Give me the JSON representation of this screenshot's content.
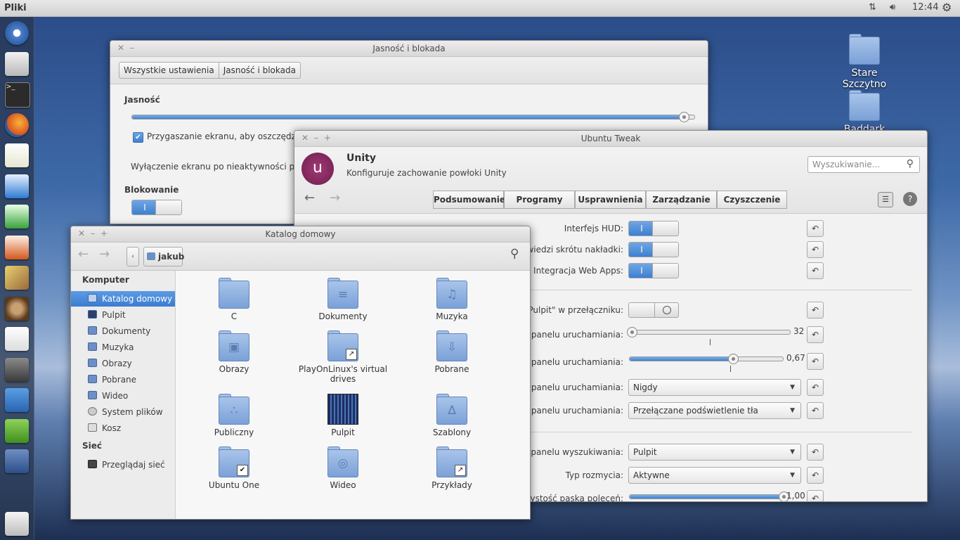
{
  "top_panel": {
    "app_title": "Pliki",
    "clock": "12:44"
  },
  "launcher": {
    "icons": [
      "ubuntu-dash-icon",
      "files-icon",
      "terminal-icon",
      "firefox-icon",
      "text-editor-icon",
      "writer-icon",
      "calc-icon",
      "impress-icon",
      "gimp-icon",
      "sound-icon",
      "apps-icon",
      "settings-icon",
      "system-monitor-icon",
      "ubuntu-tweak-icon",
      "workspace-switcher-icon",
      "trash-icon"
    ]
  },
  "desktop": {
    "icons": [
      {
        "label": "Stare Szczytno"
      },
      {
        "label": "Baddark"
      }
    ]
  },
  "brightness_window": {
    "title": "Jasność i blokada",
    "breadcrumb": [
      "Wszystkie ustawienia",
      "Jasność i blokada"
    ],
    "brightness_heading": "Jasność",
    "brightness_level": 0.98,
    "dim_checkbox_label": "Przygaszanie ekranu, aby oszczędzać zasilanie",
    "dim_checked": true,
    "screen_off_label": "Wyłączenie ekranu po nieaktywności przez:",
    "lock_heading": "Blokowanie",
    "lock_toggle_on": "I"
  },
  "tweak_window": {
    "title": "Ubuntu Tweak",
    "app_name": "Unity",
    "app_desc": "Konfiguruje zachowanie powłoki Unity",
    "logo_text": "unity",
    "search_placeholder": "Wyszukiwanie...",
    "tabs": [
      "Podsumowanie",
      "Programy",
      "Usprawnienia",
      "Zarządzanie",
      "Czyszczenie"
    ],
    "toggle_on": "I",
    "rows": {
      "hud": "Interfejs HUD:",
      "shortcut": "Podpowiedzi skrótu nakładki:",
      "webapps": "Integracja Web Apps:",
      "desktop_switcher": "Ikona \"Pokaż Pulpit\" w przełączniku:",
      "icon_size": "Rozmiar ikon panelu uruchamiania:",
      "icon_size_value": "32",
      "icon_size_level": 0.0,
      "opacity": "Przezroczystość panelu uruchamiania:",
      "opacity_value": "0,67",
      "opacity_level": 0.67,
      "hide_mode": "Tryb ukrywania panelu uruchamiania:",
      "hide_value": "Nigdy",
      "backlight": "Podświetlenie ikon panelu uruchamiania:",
      "backlight_value": "Przełączane podświetlenie tła",
      "search_size": "Rozmiar panelu wyszukiwania:",
      "search_size_value": "Pulpit",
      "blur_type": "Typ rozmycia:",
      "blur_value": "Aktywne",
      "panel_opacity": "Przezroczystość paska poleceń:",
      "panel_opacity_value": "1,00",
      "panel_opacity_level": 1.0
    }
  },
  "files_window": {
    "title": "Katalog domowy",
    "path_button": "jakub",
    "sidebar": {
      "computer_heading": "Komputer",
      "items": [
        "Katalog domowy",
        "Pulpit",
        "Dokumenty",
        "Muzyka",
        "Obrazy",
        "Pobrane",
        "Wideo",
        "System plików",
        "Kosz"
      ],
      "network_heading": "Sieć",
      "network_items": [
        "Przeglądaj sieć"
      ]
    },
    "items": [
      {
        "name": "C",
        "icon": "folder-icon"
      },
      {
        "name": "Dokumenty",
        "icon": "documents-folder-icon"
      },
      {
        "name": "Muzyka",
        "icon": "music-folder-icon"
      },
      {
        "name": "Obrazy",
        "icon": "pictures-folder-icon"
      },
      {
        "name": "PlayOnLinux's virtual drives",
        "icon": "link-folder-icon"
      },
      {
        "name": "Pobrane",
        "icon": "downloads-folder-icon"
      },
      {
        "name": "Publiczny",
        "icon": "public-folder-icon"
      },
      {
        "name": "Pulpit",
        "icon": "desktop-folder-icon"
      },
      {
        "name": "Szablony",
        "icon": "templates-folder-icon"
      },
      {
        "name": "Ubuntu One",
        "icon": "ubuntu-one-folder-icon"
      },
      {
        "name": "Wideo",
        "icon": "videos-folder-icon"
      },
      {
        "name": "Przykłady",
        "icon": "examples-link-folder-icon"
      }
    ]
  }
}
